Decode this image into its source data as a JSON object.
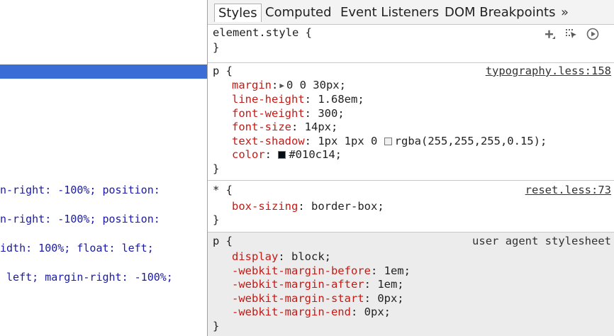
{
  "tabs": [
    "Styles",
    "Computed",
    "Event Listeners",
    "DOM Breakpoints"
  ],
  "more_tabs_glyph": "»",
  "element_style": {
    "selector": "element.style {",
    "close": "}"
  },
  "icons": [
    "add-rule-icon",
    "toggle-element-state-icon",
    "animations-icon"
  ],
  "rules": [
    {
      "selector": "p {",
      "source": "typography.less:158",
      "declarations": [
        {
          "name": "margin",
          "sep": ":",
          "value": "0 0 30px;",
          "triangle": "▶"
        },
        {
          "name": "line-height",
          "sep": ": ",
          "value": "1.68em;"
        },
        {
          "name": "font-weight",
          "sep": ": ",
          "value": "300;"
        },
        {
          "name": "font-size",
          "sep": ": ",
          "value": "14px;"
        },
        {
          "name": "text-shadow",
          "sep": ": ",
          "value_pre": "1px 1px 0 ",
          "swatch": "#f0f0f0",
          "value": "rgba(255,255,255,0.15);"
        },
        {
          "name": "color",
          "sep": ": ",
          "swatch": "#010c14",
          "value": "#010c14;"
        }
      ],
      "close": "}"
    },
    {
      "selector": "* {",
      "source": "reset.less:73",
      "declarations": [
        {
          "name": "box-sizing",
          "sep": ": ",
          "value": "border-box;"
        }
      ],
      "close": "}"
    },
    {
      "selector": "p {",
      "source": "user agent stylesheet",
      "declarations": [
        {
          "name": "display",
          "sep": ": ",
          "value": "block;"
        },
        {
          "name": "-webkit-margin-before",
          "sep": ": ",
          "value": "1em;"
        },
        {
          "name": "-webkit-margin-after",
          "sep": ": ",
          "value": "1em;"
        },
        {
          "name": "-webkit-margin-start",
          "sep": ": ",
          "value": "0px;"
        },
        {
          "name": "-webkit-margin-end",
          "sep": ": ",
          "value": "0px;"
        }
      ],
      "close": "}"
    }
  ],
  "dom_lines": [
    "n-right: -100%; position:",
    "n-right: -100%; position:",
    "idth: 100%; float: left;",
    " left; margin-right: -100%;"
  ]
}
